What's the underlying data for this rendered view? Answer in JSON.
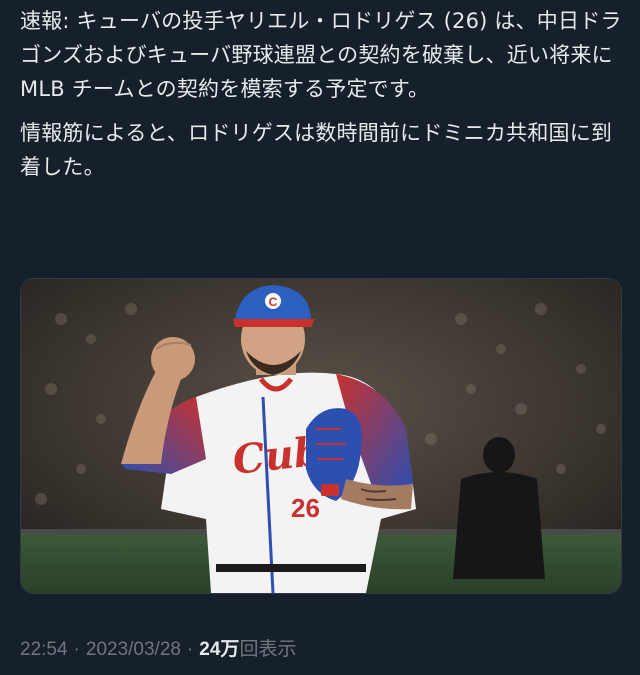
{
  "tweet": {
    "paragraphs": [
      "速報: キューバの投手ヤリエル・ロドリゲス (26) は、中日ドラゴンズおよびキューバ野球連盟との契約を破棄し、近い将来に MLB チームとの契約を模索する予定です。",
      "情報筋によると、ロドリゲスは数時間前にドミニカ共和国に到着した。"
    ],
    "media": {
      "jersey_text": "Cuba",
      "number": "26",
      "cap_letter": "C"
    },
    "time": "22:54",
    "date": "2023/03/28",
    "views_count": "24万",
    "views_label": "回表示",
    "separator": "·"
  },
  "colors": {
    "background": "#15202b",
    "text": "#e7e9ea",
    "secondary": "#71767b"
  }
}
